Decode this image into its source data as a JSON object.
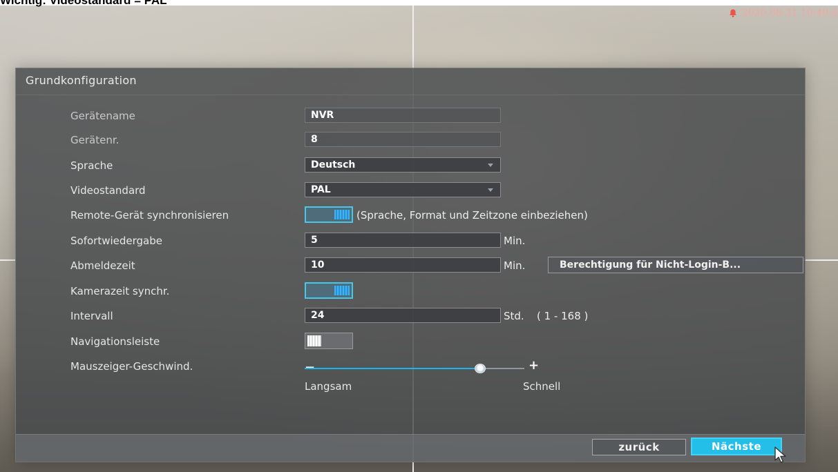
{
  "caption": "Wichtig: Videostandard = PAL",
  "clock": "2020-08-31 10:40:4",
  "icons": {
    "alarm": "alarm-bell-icon",
    "dropdown": "chevron-down-icon",
    "cursor": "mouse-pointer-icon"
  },
  "colors": {
    "accent": "#24bfe9",
    "toggle_on_border": "#49c7ea",
    "slider_fill": "#1ab6f0"
  },
  "dialog": {
    "title": "Grundkonfiguration",
    "rows": {
      "device_name": {
        "label": "Gerätename",
        "value": "NVR"
      },
      "device_no": {
        "label": "Gerätenr.",
        "value": "8"
      },
      "language": {
        "label": "Sprache",
        "value": "Deutsch"
      },
      "video_standard": {
        "label": "Videostandard",
        "value": "PAL"
      },
      "remote_sync": {
        "label": "Remote-Gerät synchronisieren",
        "enabled": true,
        "note": "(Sprache, Format und Zeitzone einbeziehen)"
      },
      "instant_playback": {
        "label": "Sofortwiedergabe",
        "value": "5",
        "unit": "Min."
      },
      "logout_time": {
        "label": "Abmeldezeit",
        "value": "10",
        "unit": "Min.",
        "button_label": "Berechtigung für Nicht-Login-B..."
      },
      "camera_time_sync": {
        "label": "Kamerazeit synchr.",
        "enabled": true
      },
      "interval": {
        "label": "Intervall",
        "value": "24",
        "unit": "Std.",
        "range": "( 1 - 168 )"
      },
      "nav_bar": {
        "label": "Navigationsleiste",
        "enabled": false
      },
      "mouse_speed": {
        "label": "Mauszeiger-Geschwind.",
        "minus": "−",
        "plus": "+",
        "min_label": "Langsam",
        "max_label": "Schnell",
        "level": 0.8
      }
    },
    "buttons": {
      "back": "zurück",
      "next": "Nächste"
    }
  }
}
